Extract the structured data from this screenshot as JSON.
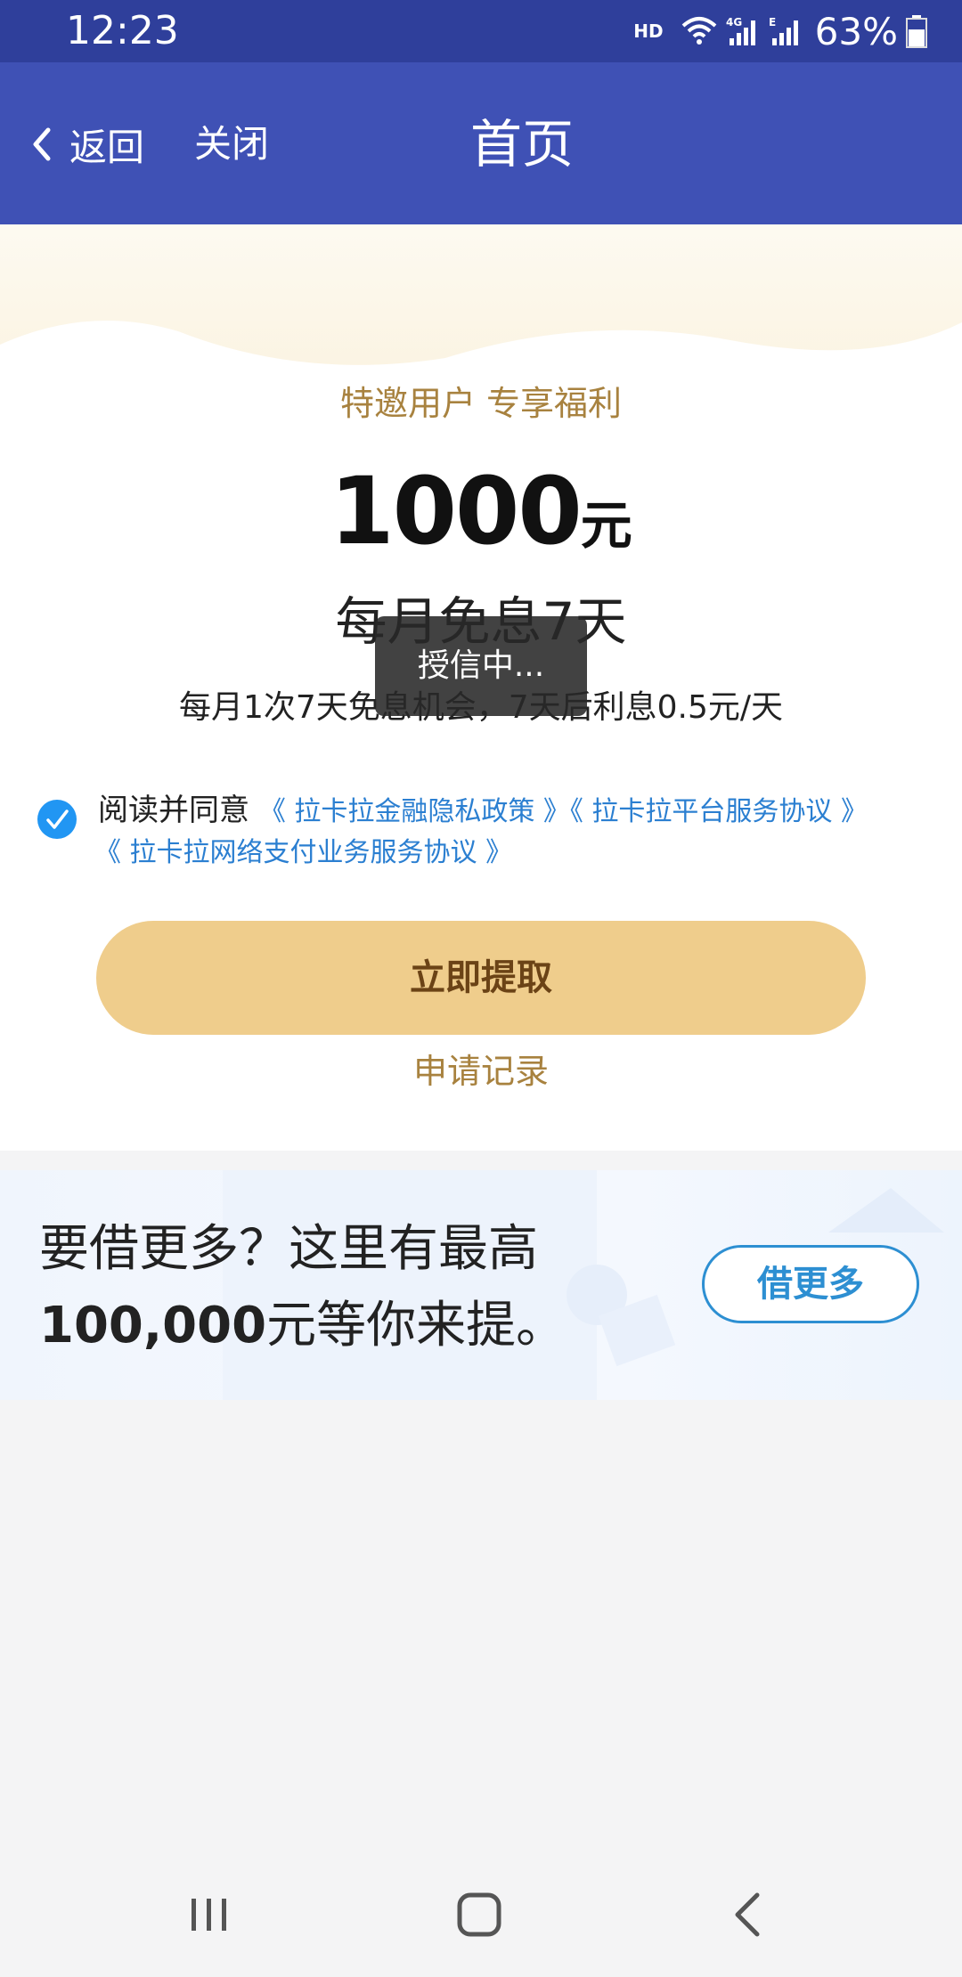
{
  "status_bar": {
    "time": "12:23",
    "network_label": "HD",
    "battery_percent": "63%",
    "battery_level": 0.63
  },
  "nav": {
    "back_label": "返回",
    "close_label": "关闭",
    "title": "首页"
  },
  "promo": {
    "subtitle": "特邀用户 专享福利",
    "amount": "1000",
    "amount_unit": "元",
    "free_interest": "每月免息7天",
    "detail": "每月1次7天免息机会，7天后利息0.5元/天",
    "toast": "授信中...",
    "agreement": {
      "checked": true,
      "prefix": "阅读并同意",
      "links": [
        "《 拉卡拉金融隐私政策 》",
        "《 拉卡拉平台服务协议 》",
        "《 拉卡拉网络支付业务服务协议 》"
      ]
    },
    "claim_button": "立即提取",
    "records_link": "申请记录"
  },
  "more_banner": {
    "line1": "要借更多？这里有最高",
    "line2_amount": "100,000",
    "line2_rest": "元等你来提。",
    "button": "借更多"
  },
  "colors": {
    "status_bar": "#2f3f9b",
    "nav_bar": "#3f51b5",
    "gold_text": "#a8823f",
    "claim_button": "#efcd8c",
    "link_blue": "#2b7fd1",
    "check_blue": "#2196f3"
  },
  "icons": {
    "back": "chevron-left-icon",
    "wifi": "wifi-icon",
    "signal": "signal-icon",
    "battery": "battery-icon",
    "check": "check-icon",
    "recents": "recents-icon",
    "home": "home-icon",
    "system_back": "back-icon"
  }
}
